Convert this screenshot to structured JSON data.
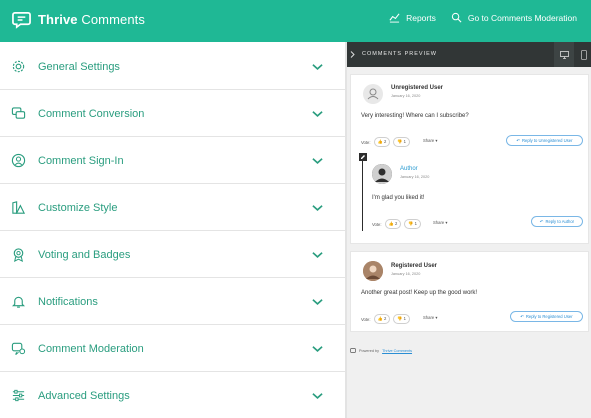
{
  "header": {
    "brand_bold": "Thrive",
    "brand_light": "Comments",
    "reports_label": "Reports",
    "moderation_label": "Go to Comments Moderation",
    "bg_color": "#1fb895"
  },
  "settings": [
    {
      "label": "General Settings",
      "icon": "gear-icon"
    },
    {
      "label": "Comment Conversion",
      "icon": "chat-icon"
    },
    {
      "label": "Comment Sign-In",
      "icon": "user-circle-icon"
    },
    {
      "label": "Customize Style",
      "icon": "brush-icon"
    },
    {
      "label": "Voting and Badges",
      "icon": "badge-icon"
    },
    {
      "label": "Notifications",
      "icon": "bell-icon"
    },
    {
      "label": "Comment Moderation",
      "icon": "chat-moderation-icon"
    },
    {
      "label": "Advanced Settings",
      "icon": "sliders-icon"
    }
  ],
  "preview": {
    "title": "COMMENTS PREVIEW",
    "comments": [
      {
        "name": "Unregistered User",
        "date": "January 16, 2020",
        "text": "Very interesting! Where can I subscribe?",
        "votes_label": "Vote:",
        "up": "2",
        "down": "1",
        "share": "Share ▾",
        "reply": "Reply to Unregistered User"
      },
      {
        "name": "Author",
        "date": "January 16, 2020",
        "text": "I'm glad you liked it!",
        "votes_label": "Vote:",
        "up": "2",
        "down": "1",
        "share": "Share ▾",
        "reply": "Reply to Author"
      },
      {
        "name": "Registered User",
        "date": "January 16, 2020",
        "text": "Another great post! Keep up the good work!",
        "votes_label": "Vote:",
        "up": "2",
        "down": "1",
        "share": "Share ▾",
        "reply": "Reply to Registered User"
      }
    ],
    "powered_prefix": "Powered by",
    "powered_link": "Thrive Comments"
  }
}
